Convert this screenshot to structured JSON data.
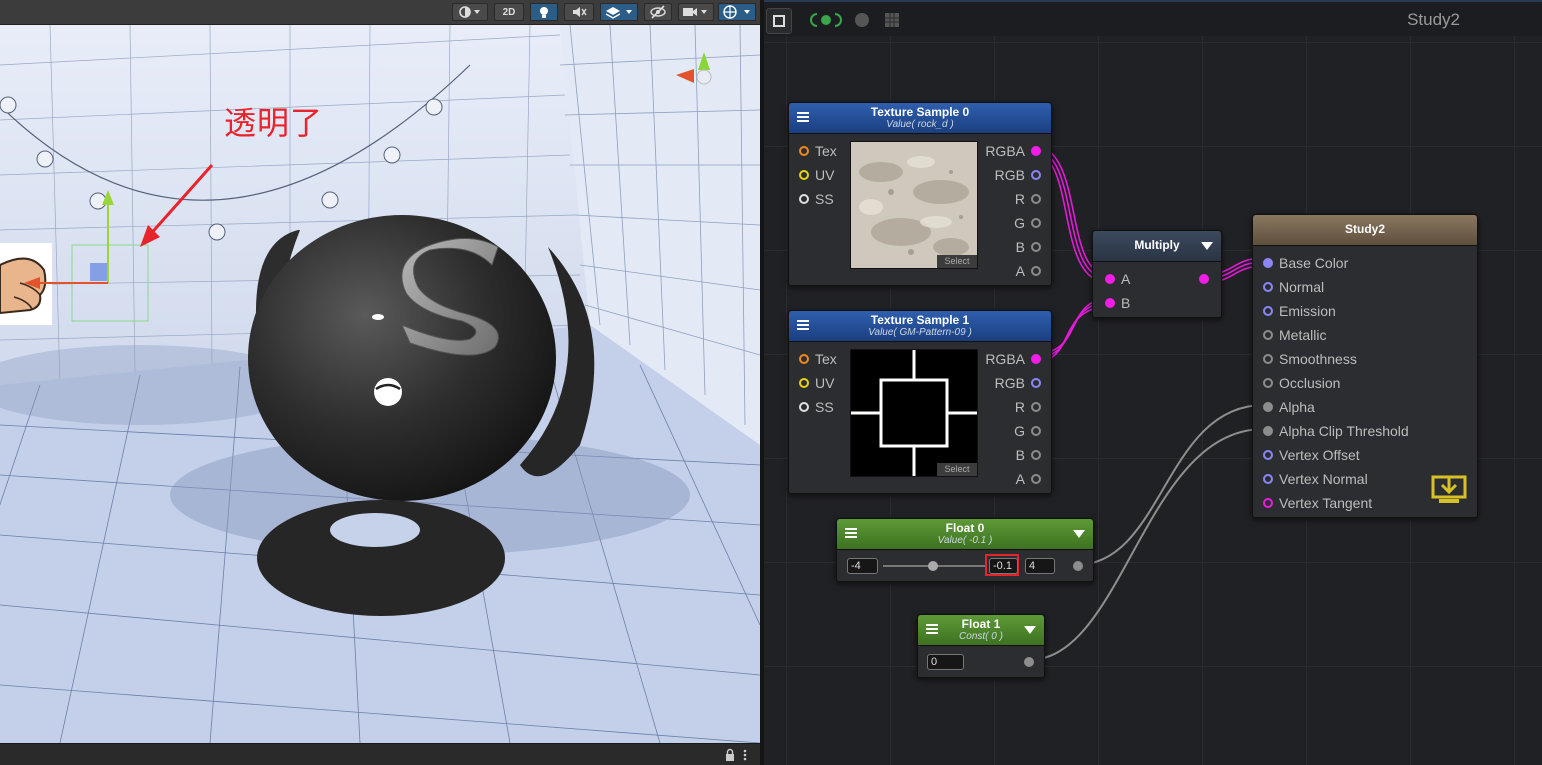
{
  "scene": {
    "toolbar": {
      "buttons": [
        {
          "name": "shading-mode",
          "icon": "sphere-shading-icon"
        },
        {
          "name": "2d-toggle",
          "label": "2D"
        },
        {
          "name": "lighting-toggle",
          "icon": "lightbulb-icon"
        },
        {
          "name": "audio-toggle",
          "icon": "speaker-icon"
        },
        {
          "name": "effects-toggle",
          "icon": "layers-icon"
        },
        {
          "name": "visibility-toggle",
          "icon": "eye-off-icon"
        },
        {
          "name": "camera-settings",
          "icon": "camera-icon"
        },
        {
          "name": "gizmos-toggle",
          "icon": "globe-gizmo-icon"
        }
      ]
    },
    "annotation": "透明了",
    "status_icons": [
      "lock-icon",
      "more-icon"
    ],
    "colors": {
      "annotation": "#e8232b"
    }
  },
  "editor": {
    "title": "Study2",
    "toolbar_icons": [
      "square-icon",
      "live-link-icon",
      "record-icon",
      "grid-icon"
    ]
  },
  "nodes": {
    "tex0": {
      "title": "Texture Sample 0",
      "subtitle": "Value( rock_d )",
      "inputs": [
        "Tex",
        "UV",
        "SS"
      ],
      "outputs": [
        "RGBA",
        "RGB",
        "R",
        "G",
        "B",
        "A"
      ],
      "select": "Select"
    },
    "tex1": {
      "title": "Texture Sample 1",
      "subtitle": "Value( GM-Pattern-09 )",
      "inputs": [
        "Tex",
        "UV",
        "SS"
      ],
      "outputs": [
        "RGBA",
        "RGB",
        "R",
        "G",
        "B",
        "A"
      ],
      "select": "Select"
    },
    "multiply": {
      "title": "Multiply",
      "inputs": [
        "A",
        "B"
      ]
    },
    "master": {
      "title": "Study2",
      "inputs": [
        "Base Color",
        "Normal",
        "Emission",
        "Metallic",
        "Smoothness",
        "Occlusion",
        "Alpha",
        "Alpha Clip Threshold",
        "Vertex Offset",
        "Vertex Normal",
        "Vertex Tangent"
      ]
    },
    "float0": {
      "title": "Float 0",
      "subtitle": "Value( -0.1 )",
      "min": "-4",
      "value": "-0.1",
      "max": "4",
      "slider_fraction": 0.49
    },
    "float1": {
      "title": "Float 1",
      "subtitle": "Const( 0 )",
      "value": "0"
    }
  },
  "colors": {
    "wire_magenta": "#e31ad8",
    "wire_gray": "#8e8e8e",
    "highlight": "#e0262b"
  }
}
